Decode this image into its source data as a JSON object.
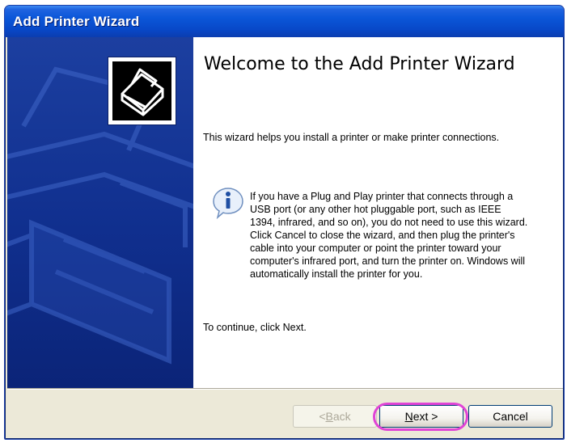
{
  "window": {
    "title": "Add Printer Wizard"
  },
  "content": {
    "heading": "Welcome to the Add Printer Wizard",
    "intro": "This wizard helps you install a printer or make printer connections.",
    "info": "If you have a Plug and Play printer that connects through a USB port (or any other hot pluggable port, such as IEEE 1394, infrared, and so on), you do not need to use this wizard. Click Cancel to close the wizard, and then plug the printer's cable into your computer or point the printer toward your computer's infrared port, and turn the printer on. Windows will automatically install the printer for you.",
    "continue": "To continue, click Next."
  },
  "buttons": {
    "back_prefix": "< ",
    "back_accel": "B",
    "back_rest": "ack",
    "next_accel": "N",
    "next_rest": "ext >",
    "cancel": "Cancel"
  },
  "icons": {
    "logo": "printer-icon",
    "info": "info-icon"
  },
  "colors": {
    "titlebar": "#0a56d8",
    "side_panel": "#102f8e",
    "highlight": "#e044d6"
  }
}
